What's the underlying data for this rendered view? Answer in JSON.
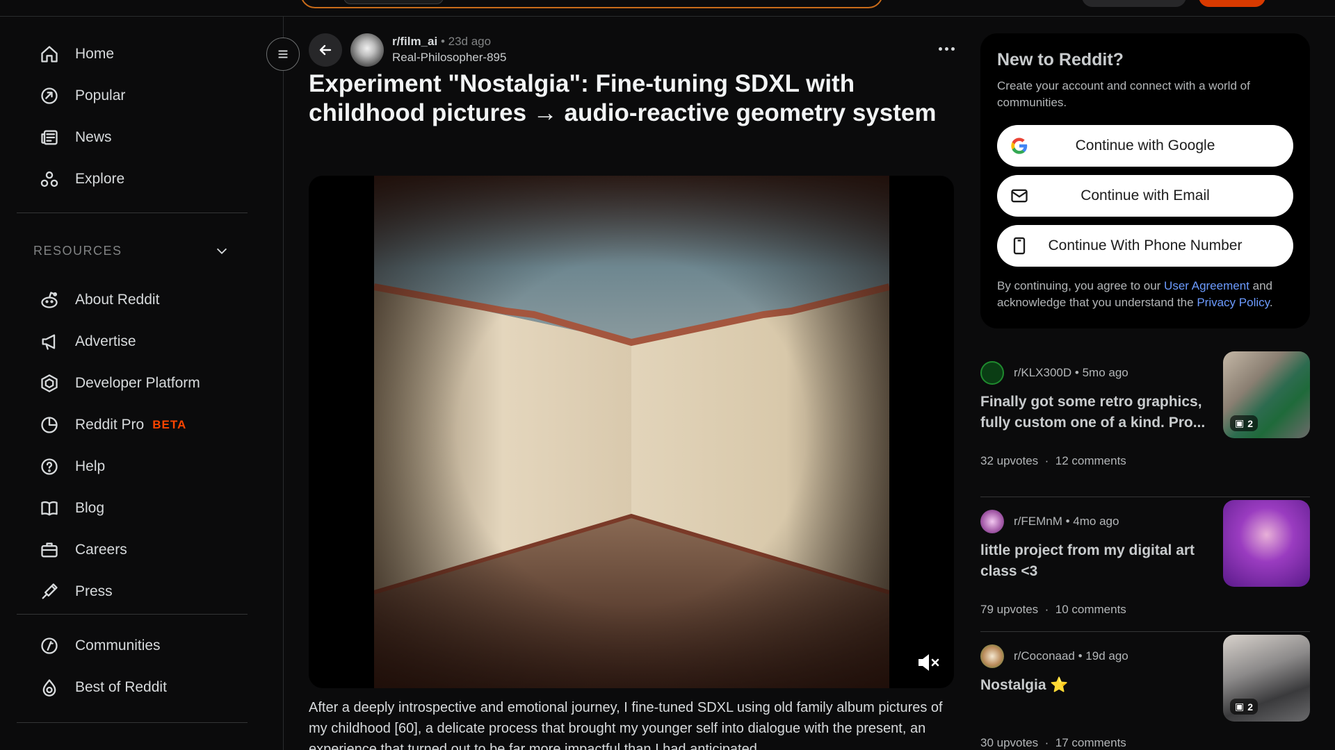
{
  "nav": {
    "primary": [
      {
        "label": "Home",
        "icon": "home-icon"
      },
      {
        "label": "Popular",
        "icon": "popular-icon"
      },
      {
        "label": "News",
        "icon": "news-icon"
      },
      {
        "label": "Explore",
        "icon": "explore-icon"
      }
    ],
    "resources_heading": "RESOURCES",
    "resources": [
      {
        "label": "About Reddit",
        "icon": "reddit-alien-icon"
      },
      {
        "label": "Advertise",
        "icon": "megaphone-icon"
      },
      {
        "label": "Developer Platform",
        "icon": "developer-platform-icon"
      },
      {
        "label": "Reddit Pro",
        "icon": "pro-chart-icon",
        "badge": "BETA"
      },
      {
        "label": "Help",
        "icon": "help-icon"
      },
      {
        "label": "Blog",
        "icon": "blog-book-icon"
      },
      {
        "label": "Careers",
        "icon": "briefcase-icon"
      },
      {
        "label": "Press",
        "icon": "press-pen-icon"
      }
    ],
    "more": [
      {
        "label": "Communities",
        "icon": "communities-icon"
      },
      {
        "label": "Best of Reddit",
        "icon": "best-of-reddit-icon"
      }
    ]
  },
  "post": {
    "subreddit": "r/film_ai",
    "age": "23d ago",
    "author": "Real-Philosopher-895",
    "title": "Experiment \"Nostalgia\": Fine-tuning SDXL with childhood pictures → audio-reactive geometry system",
    "body": "After a deeply introspective and emotional journey, I fine-tuned SDXL using old family album pictures of my childhood [60], a delicate process that brought my younger self into dialogue with the present, an experience that turned out to be far more impactful than I had anticipated."
  },
  "signup": {
    "title": "New to Reddit?",
    "description": "Create your account and connect with a world of communities.",
    "google": "Continue with Google",
    "email": "Continue with Email",
    "phone": "Continue With Phone Number",
    "legal_prefix": "By continuing, you agree to our ",
    "user_agreement": "User Agreement",
    "legal_middle": " and acknowledge that you understand the ",
    "privacy_policy": "Privacy Policy",
    "legal_suffix": "."
  },
  "related": [
    {
      "subreddit": "r/KLX300D",
      "age": "5mo ago",
      "title": "Finally got some retro graphics, fully custom one of a kind. Pro...",
      "upvotes": "32 upvotes",
      "comments": "12 comments",
      "gallery_count": "2"
    },
    {
      "subreddit": "r/FEMnM",
      "age": "4mo ago",
      "title": "little project from my digital art class <3",
      "upvotes": "79 upvotes",
      "comments": "10 comments",
      "gallery_count": ""
    },
    {
      "subreddit": "r/Coconaad",
      "age": "19d ago",
      "title": "Nostalgia ⭐",
      "upvotes": "30 upvotes",
      "comments": "17 comments",
      "gallery_count": "2"
    }
  ],
  "colors": {
    "background": "#0b0b0c",
    "accent_orange": "#ff4500",
    "link_blue": "#6c9bff"
  }
}
